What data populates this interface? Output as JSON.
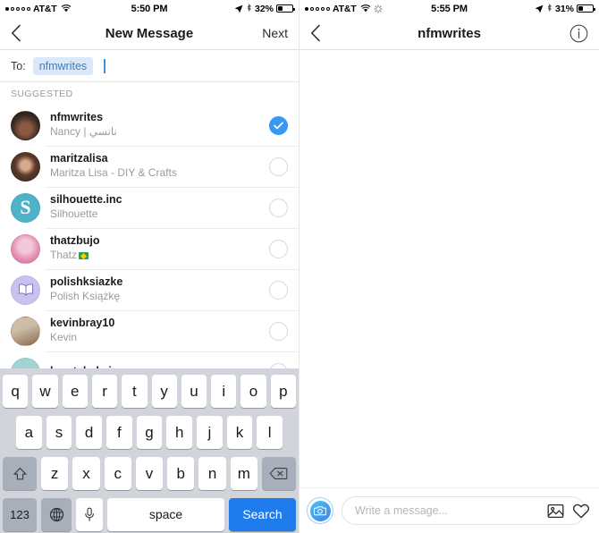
{
  "left": {
    "status": {
      "carrier": "AT&T",
      "time": "5:50 PM",
      "battery_pct": "32%",
      "signal_bars": 1
    },
    "nav": {
      "back_icon": "chevron-left-icon",
      "title": "New Message",
      "next_label": "Next"
    },
    "to_field": {
      "label": "To:",
      "chip_value": "nfmwrites"
    },
    "section_header": "SUGGESTED",
    "suggestions": [
      {
        "username": "nfmwrites",
        "fullname": "Nancy | نانسي",
        "selected": true
      },
      {
        "username": "maritzalisa",
        "fullname": "Maritza Lisa - DIY & Crafts",
        "selected": false
      },
      {
        "username": "silhouette.inc",
        "fullname": "Silhouette",
        "selected": false
      },
      {
        "username": "thatzbujo",
        "fullname": "Thatz",
        "selected": false,
        "flag": "brazil-flag"
      },
      {
        "username": "polishksiazke",
        "fullname": "Polish Książkę",
        "selected": false
      },
      {
        "username": "kevinbray10",
        "fullname": "Kevin",
        "selected": false
      },
      {
        "username": "kreatebykai",
        "fullname": "",
        "selected": false
      }
    ],
    "keyboard": {
      "row1": [
        "q",
        "w",
        "e",
        "r",
        "t",
        "y",
        "u",
        "i",
        "o",
        "p"
      ],
      "row2": [
        "a",
        "s",
        "d",
        "f",
        "g",
        "h",
        "j",
        "k",
        "l"
      ],
      "row3": [
        "z",
        "x",
        "c",
        "v",
        "b",
        "n",
        "m"
      ],
      "shift_icon": "shift-icon",
      "backspace_icon": "backspace-icon",
      "numbers_label": "123",
      "globe_icon": "globe-icon",
      "mic_icon": "microphone-icon",
      "space_label": "space",
      "search_label": "Search"
    }
  },
  "right": {
    "status": {
      "carrier": "AT&T",
      "time": "5:55 PM",
      "battery_pct": "31%",
      "signal_bars": 1
    },
    "nav": {
      "back_icon": "chevron-left-icon",
      "title": "nfmwrites",
      "info_icon": "info-icon"
    },
    "composer": {
      "camera_icon": "camera-icon",
      "placeholder": "Write a message...",
      "photo_icon": "photo-icon",
      "heart_icon": "heart-icon"
    }
  },
  "colors": {
    "accent_blue": "#3897f0",
    "chip_bg": "#d9e9f9",
    "chip_text": "#3d7fc1",
    "keyboard_bg": "#d1d4da",
    "search_key": "#1f7ced"
  }
}
